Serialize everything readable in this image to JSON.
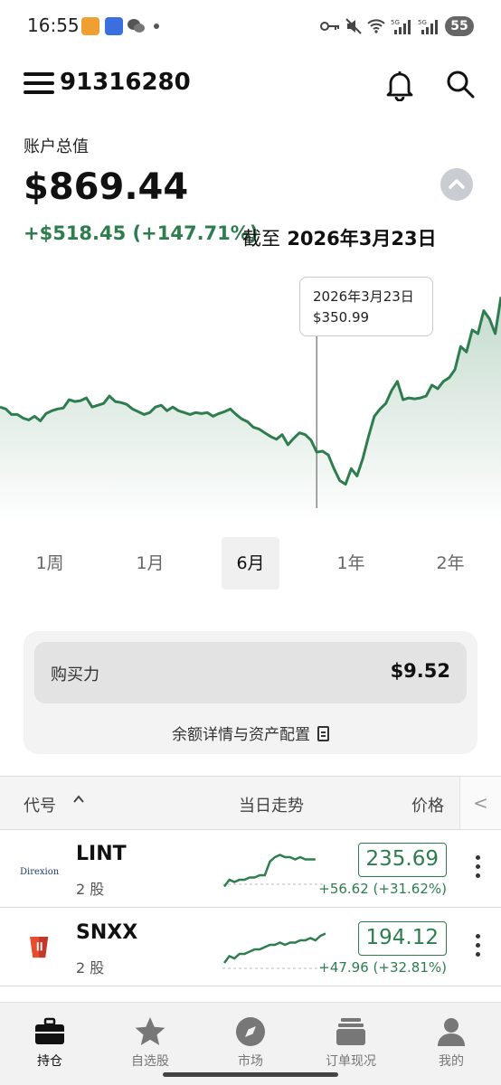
{
  "status_bar": {
    "time": "16:55",
    "battery": "55",
    "signal1": "5G",
    "signal2": "5G"
  },
  "header": {
    "account_id": "91316280"
  },
  "summary": {
    "label": "账户总值",
    "total": "$869.44",
    "gain": "+$518.45 (+147.71%)",
    "asof_prefix": "截至",
    "asof_date": "2026年3月23日"
  },
  "chart": {
    "tooltip_date": "2026年3月23日",
    "tooltip_value": "$350.99",
    "line_color": "#2e7d4f",
    "cursor_index": 55,
    "values": [
      460,
      458,
      452,
      452,
      448,
      446,
      450,
      445,
      453,
      456,
      458,
      459,
      468,
      466,
      467,
      470,
      460,
      462,
      464,
      472,
      466,
      465,
      463,
      458,
      455,
      452,
      454,
      460,
      462,
      456,
      460,
      456,
      454,
      452,
      454,
      453,
      454,
      450,
      453,
      455,
      458,
      452,
      447,
      444,
      438,
      436,
      432,
      428,
      425,
      430,
      419,
      426,
      432,
      430,
      424,
      411,
      412,
      408,
      393,
      380,
      376,
      393,
      385,
      404,
      428,
      450,
      458,
      464,
      478,
      488,
      468,
      470,
      469,
      470,
      472,
      484,
      480,
      488,
      492,
      501,
      526,
      520,
      544,
      540,
      565,
      556,
      540,
      580
    ]
  },
  "ranges": [
    "1周",
    "1月",
    "6月",
    "1年",
    "2年"
  ],
  "active_range": "6月",
  "buying_power": {
    "label": "购买力",
    "value": "$9.52",
    "detail": "余额详情与资产配置"
  },
  "table": {
    "col_symbol": "代号",
    "col_trend": "当日走势",
    "col_price": "价格",
    "scroll_glyph": "<",
    "rows": [
      {
        "ticker": "LINT",
        "shares": "2 股",
        "price": "235.69",
        "change": "+56.62 (+31.62%)",
        "logo_text": "Direxion",
        "trend": [
          3,
          6,
          5,
          6,
          6,
          7,
          7,
          8,
          8,
          14,
          16,
          17,
          16,
          16,
          15,
          16,
          15,
          15,
          15
        ]
      },
      {
        "ticker": "SNXX",
        "shares": "2 股",
        "price": "194.12",
        "change": "+47.96 (+32.81%)",
        "trend": [
          4,
          7,
          6,
          8,
          8,
          9,
          10,
          10,
          11,
          12,
          12,
          13,
          12,
          13,
          13,
          14,
          14,
          15,
          14,
          16,
          17
        ]
      }
    ]
  },
  "nav": [
    {
      "label": "持仓",
      "icon": "briefcase-icon"
    },
    {
      "label": "自选股",
      "icon": "star-icon"
    },
    {
      "label": "市场",
      "icon": "compass-icon"
    },
    {
      "label": "订单现况",
      "icon": "orders-stack-icon"
    },
    {
      "label": "我的",
      "icon": "person-icon"
    }
  ],
  "colors": {
    "accent": "#2e7d4f",
    "text": "#111111"
  }
}
